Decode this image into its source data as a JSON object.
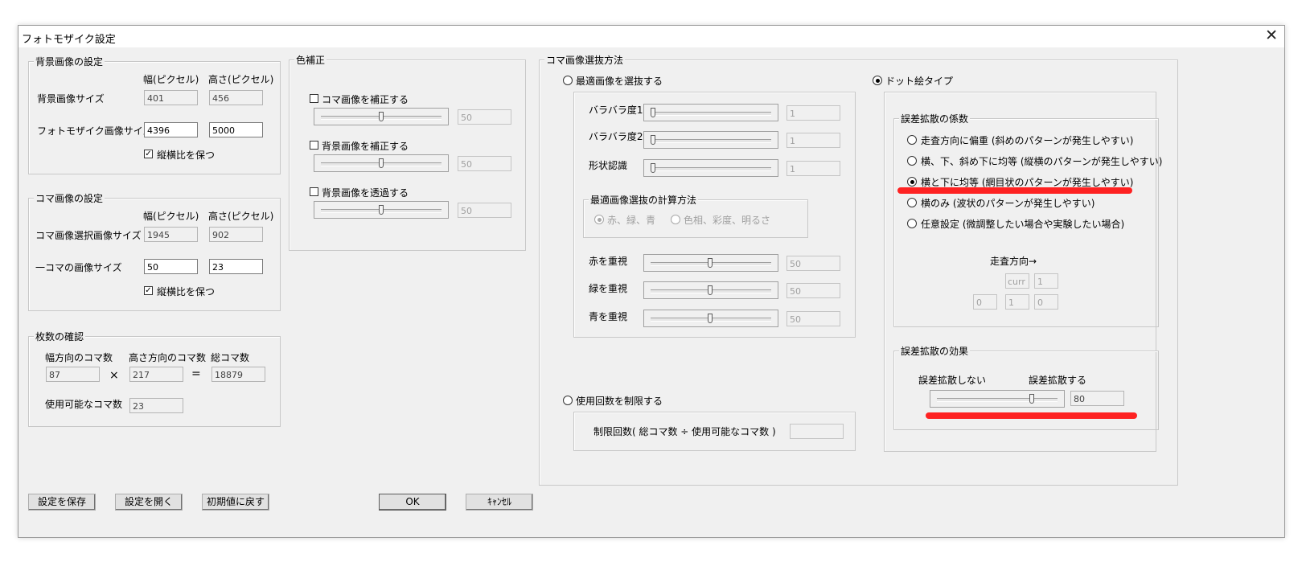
{
  "window": {
    "title": "フォトモザイク設定",
    "close_glyph": "✕"
  },
  "background": {
    "legend": "背景画像の設定",
    "col_width": "幅(ピクセル)",
    "col_height": "高さ(ピクセル)",
    "row1_label": "背景画像サイズ",
    "row1_w": "401",
    "row1_h": "456",
    "row2_label": "フォトモザイク画像サイズ",
    "row2_w": "4396",
    "row2_h": "5000",
    "keep_ratio_label": "縦横比を保つ",
    "keep_ratio_checked": true
  },
  "tile": {
    "legend": "コマ画像の設定",
    "col_width": "幅(ピクセル)",
    "col_height": "高さ(ピクセル)",
    "row1_label": "コマ画像選択画像サイズ",
    "row1_w": "1945",
    "row1_h": "902",
    "row2_label": "一コマの画像サイズ",
    "row2_w": "50",
    "row2_h": "23",
    "keep_ratio_label": "縦横比を保つ",
    "keep_ratio_checked": true
  },
  "count": {
    "legend": "枚数の確認",
    "h_label": "幅方向のコマ数",
    "v_label": "高さ方向のコマ数",
    "total_label": "総コマ数",
    "h_value": "87",
    "times": "×",
    "v_value": "217",
    "equals": "=",
    "total_value": "18879",
    "usable_label": "使用可能なコマ数",
    "usable_value": "23"
  },
  "color": {
    "legend": "色補正",
    "opt1_label": "コマ画像を補正する",
    "opt1_value": "50",
    "opt1_level": 0.5,
    "opt2_label": "背景画像を補正する",
    "opt2_value": "50",
    "opt2_level": 0.5,
    "opt3_label": "背景画像を透過する",
    "opt3_value": "50",
    "opt3_level": 0.5
  },
  "select": {
    "legend": "コマ画像選抜方法",
    "optimal_label": "最適画像を選抜する",
    "scatter1_label": "バラバラ度1",
    "scatter1_value": "1",
    "scatter2_label": "バラバラ度2",
    "scatter2_value": "1",
    "shape_label": "形状認識",
    "shape_value": "1",
    "calc_legend": "最適画像選抜の計算方法",
    "calc_opt1": "赤、緑、青",
    "calc_opt2": "色相、彩度、明るさ",
    "red_label": "赤を重視",
    "red_value": "50",
    "green_label": "緑を重視",
    "green_value": "50",
    "blue_label": "青を重視",
    "blue_value": "50",
    "limit_label": "使用回数を制限する",
    "limit_formula": "制限回数( 総コマ数 ÷ 使用可能なコマ数 )",
    "limit_value": "",
    "dot_label": "ドット絵タイプ",
    "coef_legend": "誤差拡散の係数",
    "coef_opt1": "走査方向に偏重 (斜めのパターンが発生しやすい)",
    "coef_opt2": "横、下、斜め下に均等 (縦横のパターンが発生しやすい)",
    "coef_opt3": "横と下に均等 (網目状のパターンが発生しやすい)",
    "coef_opt4": "横のみ (波状のパターンが発生しやすい)",
    "coef_opt5": "任意設定 (微調整したい場合や実験したい場合)",
    "scan_dir": "走査方向→",
    "grid_curr": "curr",
    "grid_right": "1",
    "grid_bl": "0",
    "grid_b": "1",
    "grid_br": "0",
    "effect_legend": "誤差拡散の効果",
    "effect_none": "誤差拡散しない",
    "effect_do": "誤差拡散する",
    "effect_value": "80",
    "effect_level": 0.8
  },
  "buttons": {
    "save": "設定を保存",
    "open": "設定を開く",
    "reset": "初期値に戻す",
    "ok": "OK",
    "cancel": "ｷｬﾝｾﾙ"
  },
  "highlight_color": "#ff1010"
}
